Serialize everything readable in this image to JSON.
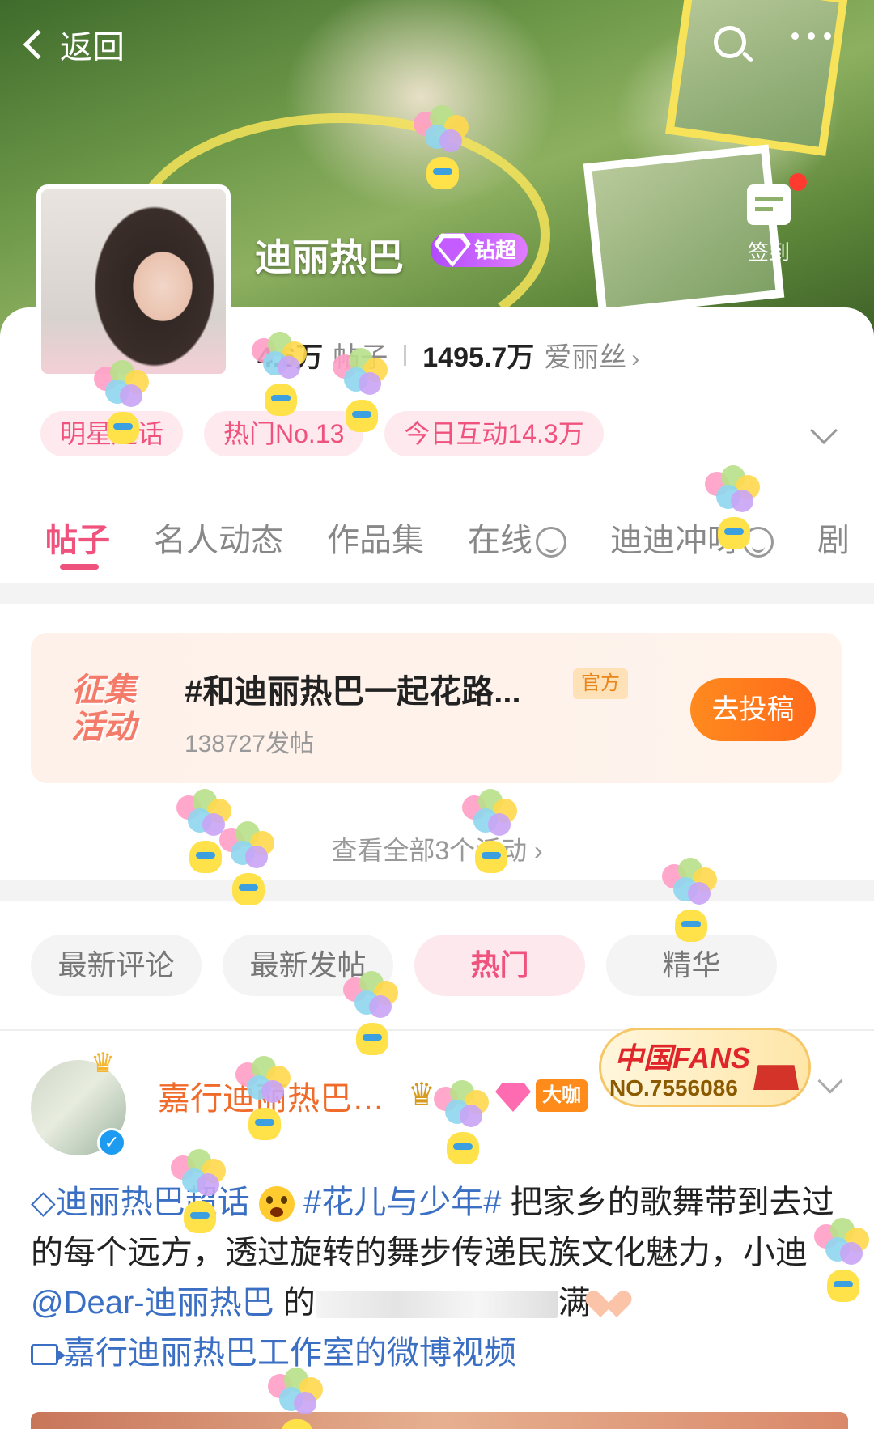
{
  "header": {
    "back_label": "返回",
    "community_name": "迪丽热巴",
    "badge_label": "钻超",
    "checkin_label": "签到"
  },
  "stats": {
    "posts_value": "4.6万",
    "posts_label": "帖子",
    "fans_value": "1495.7万",
    "fans_label": "爱丽丝"
  },
  "tags": [
    "明星超话",
    "热门No.13",
    "今日互动14.3万"
  ],
  "tabs": [
    "帖子",
    "名人动态",
    "作品集",
    "在线",
    "迪迪冲呀",
    "剧"
  ],
  "activity": {
    "stamp_line1": "征集",
    "stamp_line2": "活动",
    "title": "#和迪丽热巴一起花路...",
    "official_label": "官方",
    "count": "138727发帖",
    "submit_label": "去投稿",
    "view_all": "查看全部3个活动 ›"
  },
  "sorts": [
    "最新评论",
    "最新发帖",
    "热门",
    "精华"
  ],
  "post": {
    "author": "嘉行迪丽热巴…",
    "level_badge": "大咖",
    "fans_brand": "中国FANS",
    "fans_no": "NO.7556086",
    "super_topic_link": "迪丽热巴超话",
    "hashtag": "#花儿与少年#",
    "text_1": " 把家乡的歌舞带到去过的每个远方，透过旋转的舞步传递民族文化魅力，小迪 ",
    "mention": "@Dear-迪丽热巴",
    "text_2": " 的",
    "text_3": "满",
    "video_link": "嘉行迪丽热巴工作室的微博视频"
  },
  "colors": {
    "accent_pink": "#f0527e",
    "link_blue": "#3a6fc4",
    "author_orange": "#f06a2a",
    "submit_orange": "#ff7a1e"
  }
}
